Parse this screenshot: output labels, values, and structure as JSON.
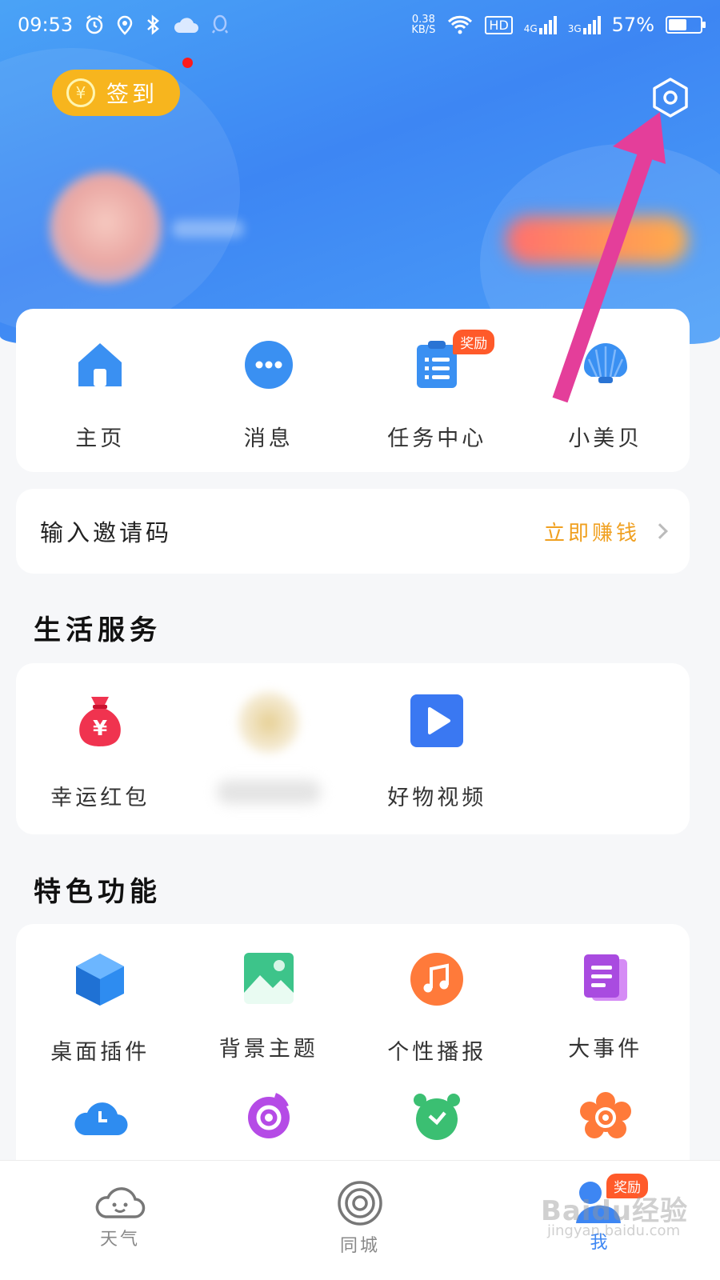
{
  "status_bar": {
    "time": "09:53",
    "net_speed_value": "0.38",
    "net_speed_unit": "KB/S",
    "hd": "HD",
    "sim1": "4G",
    "sim2": "3G",
    "battery": "57%",
    "battery_level": 0.57
  },
  "header": {
    "signin_label": "签到",
    "yen_symbol": "¥"
  },
  "quick_actions": [
    {
      "label": "主页",
      "icon": "home-icon"
    },
    {
      "label": "消息",
      "icon": "message-icon"
    },
    {
      "label": "任务中心",
      "icon": "task-icon",
      "badge": "奖励"
    },
    {
      "label": "小美贝",
      "icon": "shell-icon"
    }
  ],
  "invite": {
    "title": "输入邀请码",
    "action": "立即赚钱"
  },
  "life_services": {
    "title": "生活服务",
    "items": [
      {
        "label": "幸运红包",
        "icon": "money-bag-icon"
      },
      {
        "label": "",
        "icon": "blurred-icon"
      },
      {
        "label": "好物视频",
        "icon": "play-video-icon"
      }
    ]
  },
  "features": {
    "title": "特色功能",
    "items": [
      {
        "label": "桌面插件",
        "icon": "cube-icon"
      },
      {
        "label": "背景主题",
        "icon": "image-icon"
      },
      {
        "label": "个性播报",
        "icon": "music-icon"
      },
      {
        "label": "大事件",
        "icon": "document-icon"
      }
    ],
    "row2_icons": [
      "cloud-clock-icon",
      "typhoon-icon",
      "alarm-clock-icon",
      "flower-icon"
    ]
  },
  "bottom_nav": {
    "tabs": [
      {
        "label": "天气",
        "icon": "weather-cloud-icon"
      },
      {
        "label": "同城",
        "icon": "local-circle-icon"
      },
      {
        "label": "我",
        "icon": "profile-icon",
        "badge": "奖励"
      }
    ],
    "active_index": 2
  },
  "watermark": {
    "brand": "Baidu经验",
    "url": "jingyan.baidu.com"
  },
  "colors": {
    "header_blue": "#3d86f3",
    "signin_yellow": "#f7b51e",
    "badge_orange": "#ff5a2a",
    "arrow_pink": "#e43e9a",
    "action_orange": "#f0a020"
  }
}
